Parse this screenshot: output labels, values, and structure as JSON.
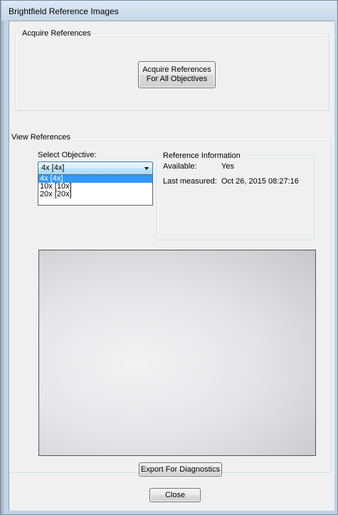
{
  "window": {
    "title": "Brightfield Reference Images"
  },
  "acquire": {
    "group_label": "Acquire References",
    "button_line1": "Acquire References",
    "button_line2": "For All Objectives"
  },
  "view": {
    "group_label": "View References",
    "select_label": "Select Objective:",
    "selected_value": "4x [4x]",
    "options": [
      "4x [4x]",
      "10x [10x]",
      "20x [20x]"
    ],
    "info": {
      "group_label": "Reference Information",
      "available_label": "Available:",
      "available_value": "Yes",
      "measured_label": "Last measured:",
      "measured_value": "Oct 26, 2015 08:27:16"
    },
    "export_button": "Export For Diagnostics"
  },
  "footer": {
    "close_button": "Close"
  },
  "colors": {
    "selection": "#3399ff",
    "frame": "#bcd2e8"
  }
}
